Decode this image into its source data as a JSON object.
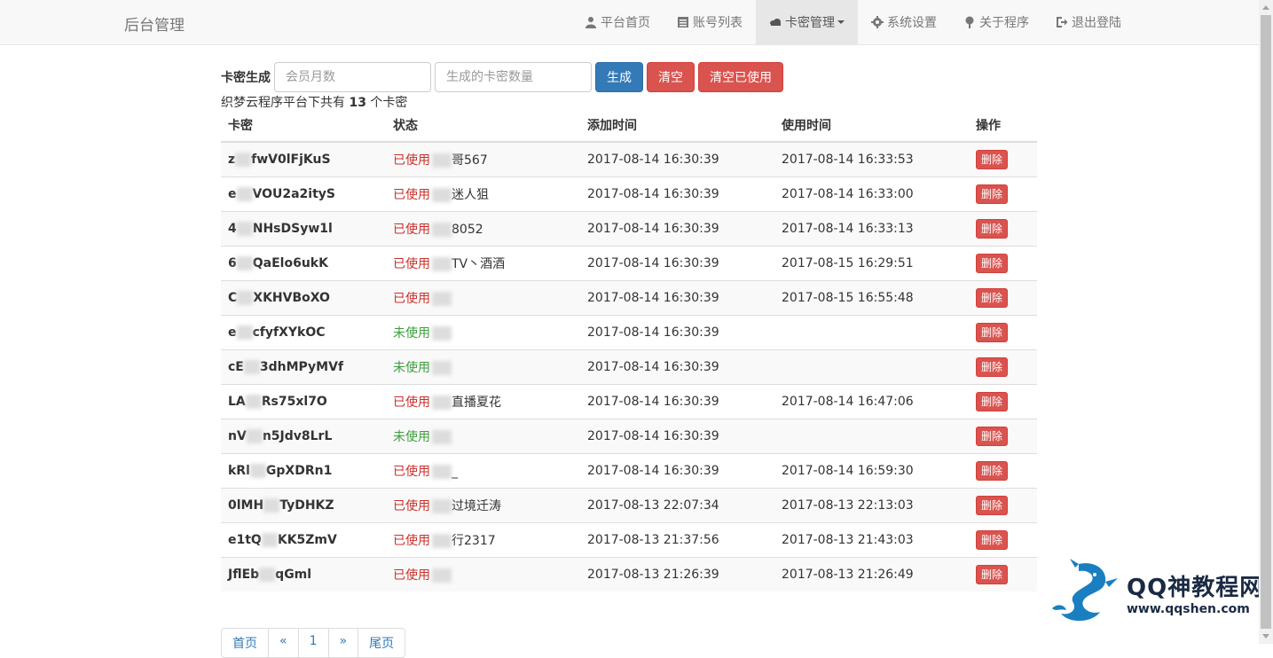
{
  "app": {
    "brand": "后台管理"
  },
  "nav": {
    "items": [
      {
        "label": "平台首页",
        "icon": "user-icon"
      },
      {
        "label": "账号列表",
        "icon": "list-icon"
      },
      {
        "label": "卡密管理",
        "icon": "cloud-icon",
        "active": true
      },
      {
        "label": "系统设置",
        "icon": "gear-icon"
      },
      {
        "label": "关于程序",
        "icon": "tree-icon"
      },
      {
        "label": "退出登陆",
        "icon": "logout-icon"
      }
    ]
  },
  "toolbar": {
    "label": "卡密生成",
    "months_placeholder": "会员月数",
    "count_placeholder": "生成的卡密数量",
    "generate_label": "生成",
    "clear_label": "清空",
    "clear_used_label": "清空已使用"
  },
  "summary": {
    "prefix": "织梦云程序平台下共有 ",
    "count": "13",
    "suffix": " 个卡密"
  },
  "table": {
    "headers": [
      "卡密",
      "状态",
      "添加时间",
      "使用时间",
      "操作"
    ],
    "delete_label": "删除",
    "rows": [
      {
        "key_a": "z",
        "key_b": "fwV0lFjKuS",
        "status": "已使用",
        "used": true,
        "user": "哥567",
        "added": "2017-08-14 16:30:39",
        "used_at": "2017-08-14 16:33:53"
      },
      {
        "key_a": "e",
        "key_b": "VOU2a2ityS",
        "status": "已使用",
        "used": true,
        "user": "迷人狙",
        "added": "2017-08-14 16:30:39",
        "used_at": "2017-08-14 16:33:00"
      },
      {
        "key_a": "4",
        "key_b": "NHsDSyw1l",
        "status": "已使用",
        "used": true,
        "user": "8052",
        "added": "2017-08-14 16:30:39",
        "used_at": "2017-08-14 16:33:13"
      },
      {
        "key_a": "6",
        "key_b": "QaElo6ukK",
        "status": "已使用",
        "used": true,
        "user": "TV丶酒酒",
        "added": "2017-08-14 16:30:39",
        "used_at": "2017-08-15 16:29:51"
      },
      {
        "key_a": "C",
        "key_b": "XKHVBoXO",
        "status": "已使用",
        "used": true,
        "user": "",
        "added": "2017-08-14 16:30:39",
        "used_at": "2017-08-15 16:55:48"
      },
      {
        "key_a": "e",
        "key_b": "cfyfXYkOC",
        "status": "未使用",
        "used": false,
        "user": "",
        "added": "2017-08-14 16:30:39",
        "used_at": ""
      },
      {
        "key_a": "cE",
        "key_b": "3dhMPyMVf",
        "status": "未使用",
        "used": false,
        "user": "",
        "added": "2017-08-14 16:30:39",
        "used_at": ""
      },
      {
        "key_a": "LA",
        "key_b": "Rs75xl7O",
        "status": "已使用",
        "used": true,
        "user": "直播夏花",
        "added": "2017-08-14 16:30:39",
        "used_at": "2017-08-14 16:47:06"
      },
      {
        "key_a": "nV",
        "key_b": "n5Jdv8LrL",
        "status": "未使用",
        "used": false,
        "user": "",
        "added": "2017-08-14 16:30:39",
        "used_at": ""
      },
      {
        "key_a": "kRl",
        "key_b": "GpXDRn1",
        "status": "已使用",
        "used": true,
        "user": "_",
        "added": "2017-08-14 16:30:39",
        "used_at": "2017-08-14 16:59:30"
      },
      {
        "key_a": "0lMH",
        "key_b": "TyDHKZ",
        "status": "已使用",
        "used": true,
        "user": "过境迁涛",
        "added": "2017-08-13 22:07:34",
        "used_at": "2017-08-13 22:13:03"
      },
      {
        "key_a": "e1tQ",
        "key_b": "KK5ZmV",
        "status": "已使用",
        "used": true,
        "user": "行2317",
        "added": "2017-08-13 21:37:56",
        "used_at": "2017-08-13 21:43:03"
      },
      {
        "key_a": "JflEb",
        "key_b": "qGml",
        "status": "已使用",
        "used": true,
        "user": "",
        "added": "2017-08-13 21:26:39",
        "used_at": "2017-08-13 21:26:49"
      }
    ]
  },
  "pagination": {
    "first": "首页",
    "prev": "«",
    "page": "1",
    "next": "»",
    "last": "尾页"
  },
  "watermark": {
    "title": "QQ神教程网",
    "url": "www.qqshen.com"
  },
  "colors": {
    "primary": "#337ab7",
    "danger": "#d9534f",
    "used": "#c9302c",
    "unused": "#3c9f3c"
  }
}
